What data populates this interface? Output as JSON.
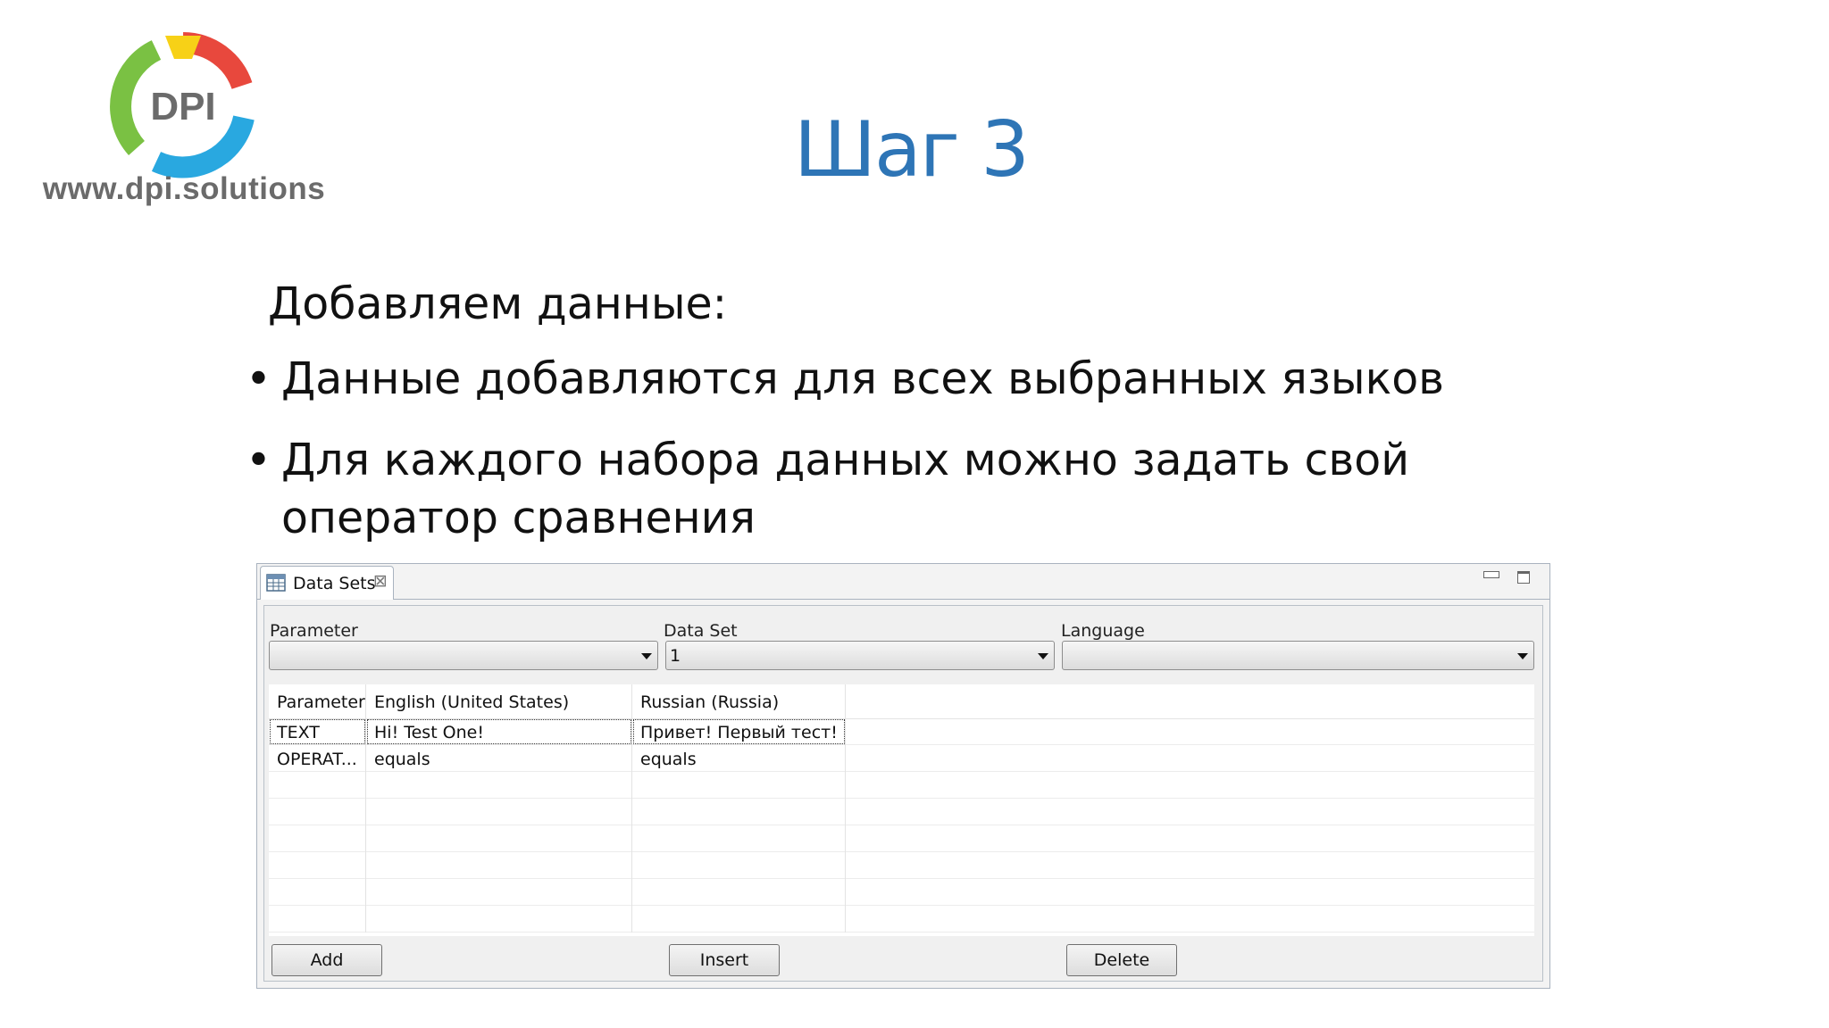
{
  "logo": {
    "text": "DPI",
    "url": "www.dpi.solutions"
  },
  "slide": {
    "title": "Шаг 3",
    "subtitle": "Добавляем данные:",
    "bullets": [
      "Данные добавляются для всех выбранных языков",
      "Для каждого набора данных можно задать свой оператор сравнения"
    ]
  },
  "window": {
    "tab_label": "Data Sets",
    "parameter_label": "Parameter",
    "dataset_label": "Data Set",
    "language_label": "Language",
    "parameter_value": "",
    "dataset_value": "1",
    "language_value": "",
    "columns": [
      "Parameter",
      "English (United States)",
      "Russian (Russia)"
    ],
    "rows": [
      [
        "TEXT",
        "Hi! Test One!",
        "Привет! Первый тест!"
      ],
      [
        "OPERAT...",
        "equals",
        "equals"
      ]
    ],
    "buttons": {
      "add": "Add",
      "insert": "Insert",
      "delete": "Delete"
    }
  },
  "colors": {
    "title": "#2e75b6",
    "logo_green": "#7ac143",
    "logo_red": "#e8483d",
    "logo_blue": "#29a8e0",
    "logo_yellow": "#f7d117"
  }
}
